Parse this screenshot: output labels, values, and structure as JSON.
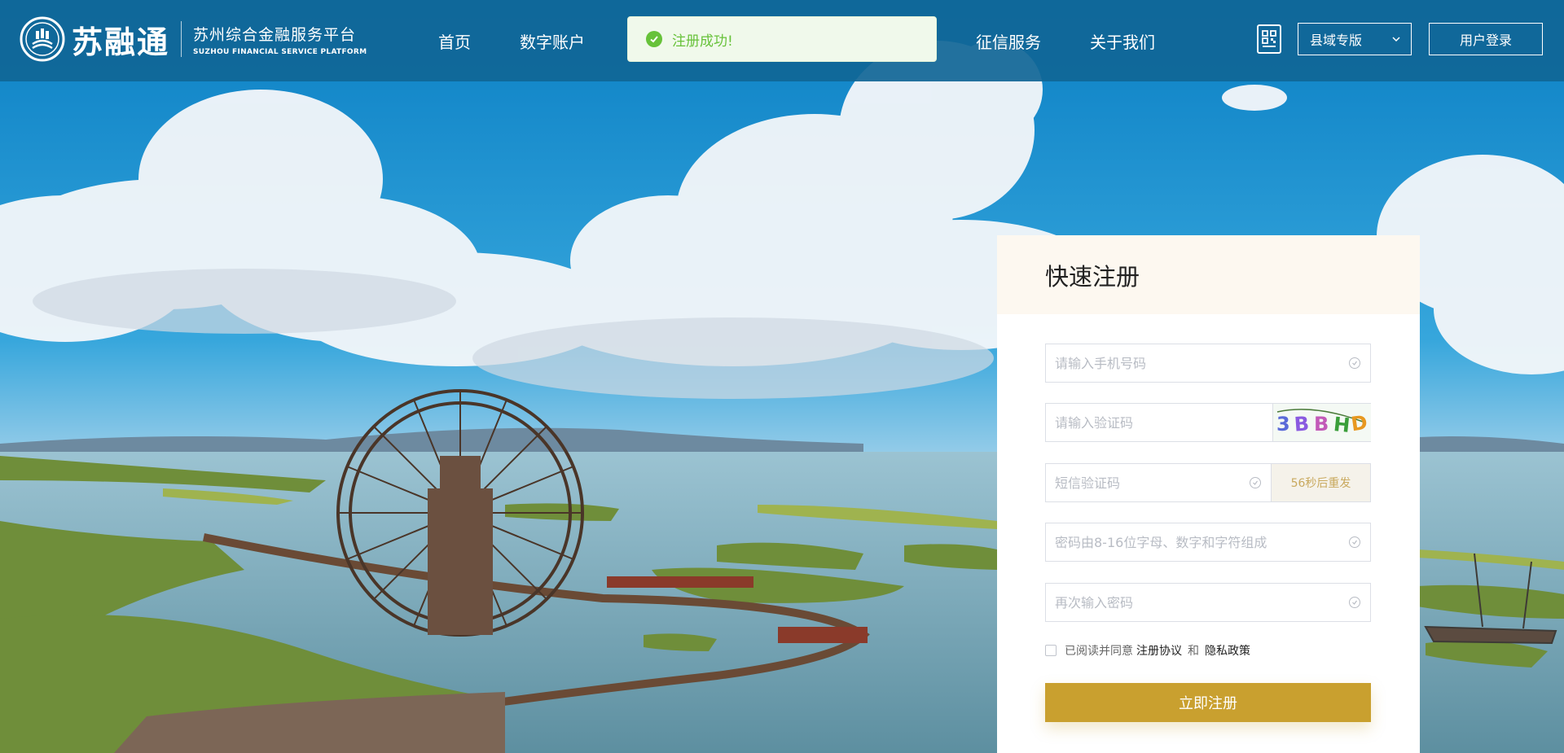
{
  "header": {
    "logo_name": "苏融通",
    "logo_sub_cn": "苏州综合金融服务平台",
    "logo_sub_en": "SUZHOU FINANCIAL SERVICE PLATFORM",
    "nav": [
      {
        "label": "首页"
      },
      {
        "label": "数字账户"
      },
      {
        "label": "征信服务"
      },
      {
        "label": "关于我们"
      }
    ],
    "qr_icon": "qr-code-icon",
    "region_select": {
      "value": "县域专版",
      "icon": "chevron-down-icon"
    },
    "login_label": "用户登录"
  },
  "toast": {
    "text": "注册成功!",
    "icon": "check-circle-icon",
    "color": "#67c23a"
  },
  "register": {
    "title": "快速注册",
    "fields": {
      "phone": {
        "placeholder": "请输入手机号码",
        "value": ""
      },
      "captcha": {
        "placeholder": "请输入验证码",
        "value": "",
        "captcha_image_text": "3BBHD"
      },
      "sms": {
        "placeholder": "短信验证码",
        "value": "",
        "resend_label": "56秒后重发"
      },
      "password": {
        "placeholder": "密码由8-16位字母、数字和字符组成",
        "value": ""
      },
      "confirm_password": {
        "placeholder": "再次输入密码",
        "value": ""
      }
    },
    "agreement": {
      "prefix": "已阅读并同意",
      "terms_link": "注册协议",
      "conjunction": "和",
      "privacy_link": "隐私政策",
      "checked": false
    },
    "submit_label": "立即注册"
  },
  "colors": {
    "header_bg": "#106696",
    "accent_gold": "#c9a02f",
    "success_green": "#67c23a",
    "card_head_bg": "#fdf8f0"
  }
}
